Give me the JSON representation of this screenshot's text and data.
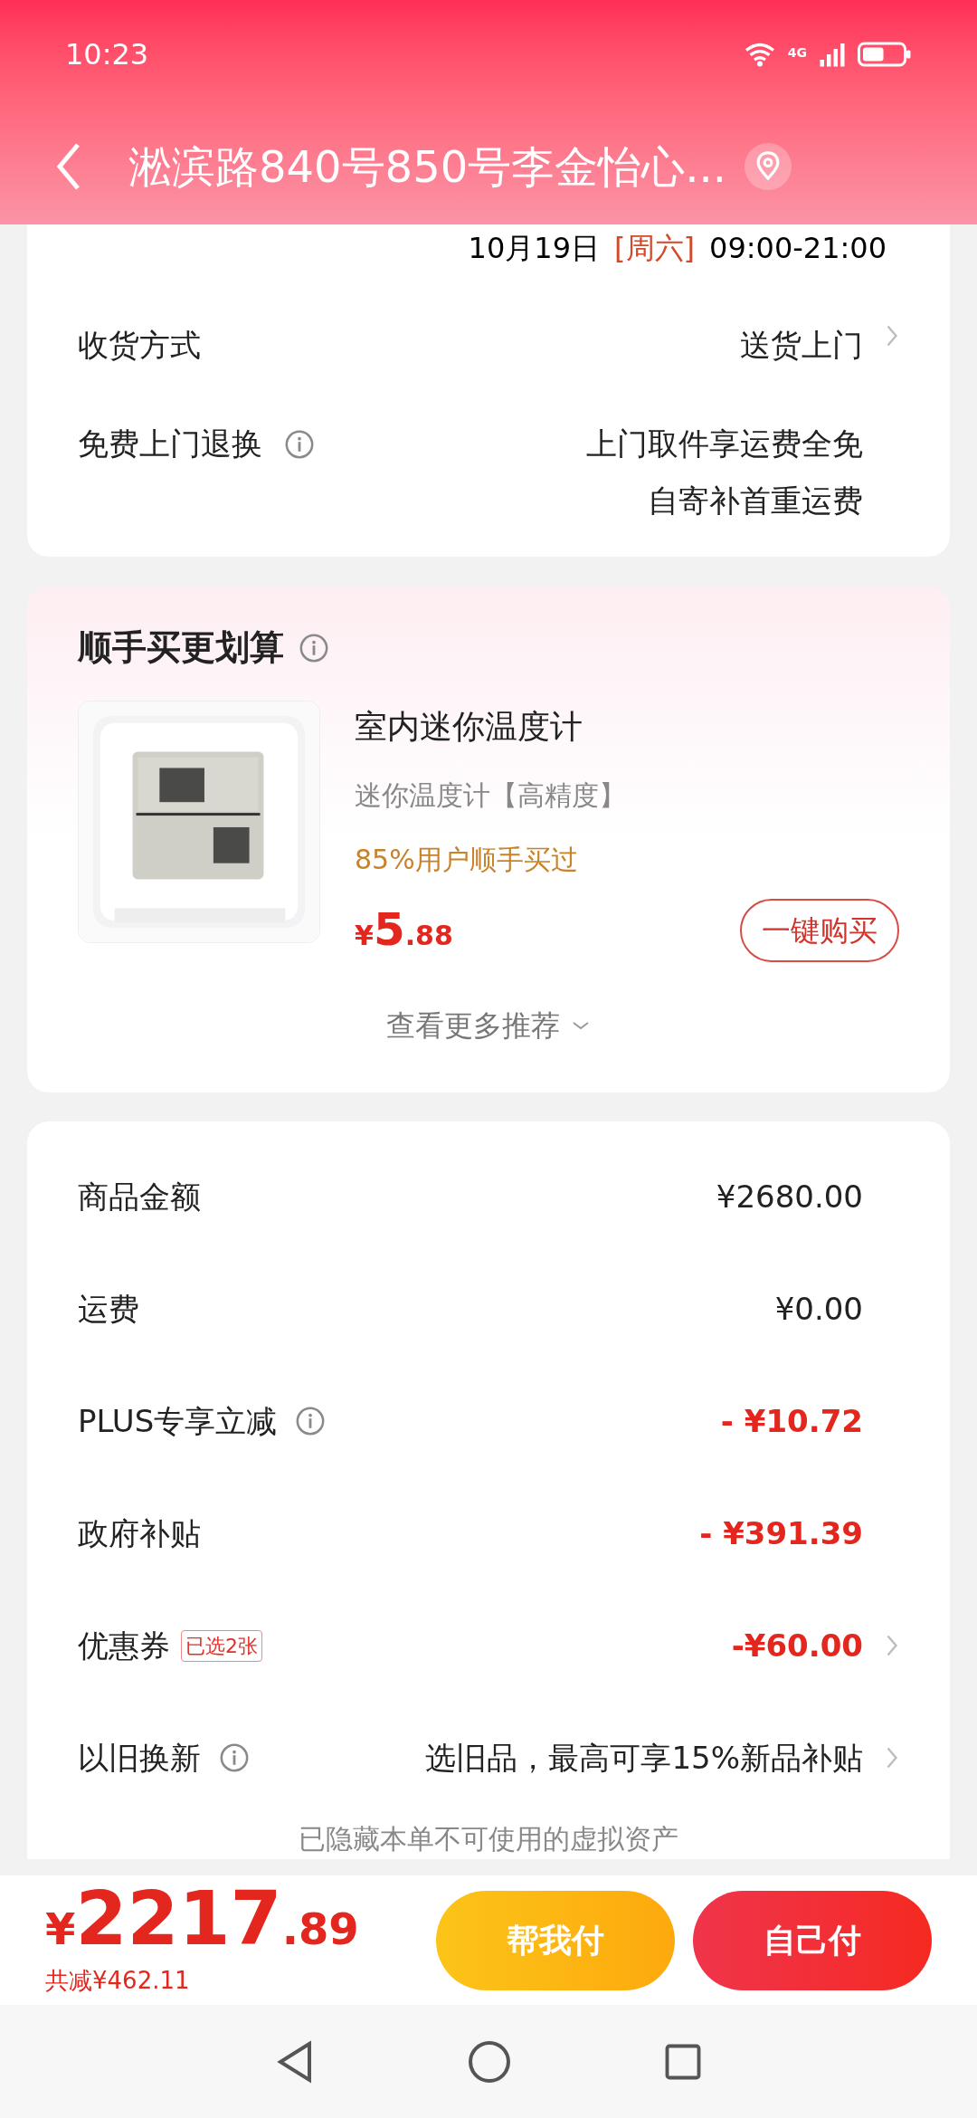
{
  "status_bar": {
    "time": "10:23",
    "network": "4G"
  },
  "header": {
    "title": "淞滨路840号850号李金怡心..."
  },
  "delivery": {
    "date": "10月19日",
    "weekday": "[周六]",
    "time_range": "09:00-21:00",
    "rows": [
      {
        "label": "收货方式",
        "info": false,
        "value_lines": [
          "送货上门"
        ],
        "has_arrow": true
      },
      {
        "label": "免费上门退换",
        "info": true,
        "value_lines": [
          "上门取件享运费全免",
          "自寄补首重运费"
        ],
        "has_arrow": false
      }
    ]
  },
  "recommend": {
    "title": "顺手买更划算",
    "product": {
      "name": "室内迷你温度计",
      "spec": "迷你温度计【高精度】",
      "social_proof": "85%用户顺手买过",
      "currency": "¥",
      "price_int": "5",
      "price_dec": ".88",
      "buy_button": "一键购买"
    },
    "more": "查看更多推荐"
  },
  "price_rows": [
    {
      "label": "商品金额",
      "info": false,
      "badge": null,
      "value": "¥2680.00",
      "highlight": false,
      "has_arrow": false
    },
    {
      "label": "运费",
      "info": false,
      "badge": null,
      "value": "¥0.00",
      "highlight": false,
      "has_arrow": false
    },
    {
      "label": "PLUS专享立减",
      "info": true,
      "badge": null,
      "value": "- ¥10.72",
      "highlight": true,
      "has_arrow": false
    },
    {
      "label": "政府补贴",
      "info": false,
      "badge": null,
      "value": "- ¥391.39",
      "highlight": true,
      "has_arrow": false
    },
    {
      "label": "优惠券",
      "info": false,
      "badge": "已选2张",
      "value": "-¥60.00",
      "highlight": true,
      "has_arrow": true
    },
    {
      "label": "以旧换新",
      "info": true,
      "badge": null,
      "value": "选旧品，最高可享15%新品补贴",
      "highlight": false,
      "has_arrow": true
    }
  ],
  "hidden_assets": "已隐藏本单不可使用的虚拟资产",
  "checkout": {
    "currency": "¥",
    "total_int": "2217",
    "total_dec": ".89",
    "saved": "共减¥462.11",
    "help_pay": "帮我付",
    "self_pay": "自己付"
  }
}
